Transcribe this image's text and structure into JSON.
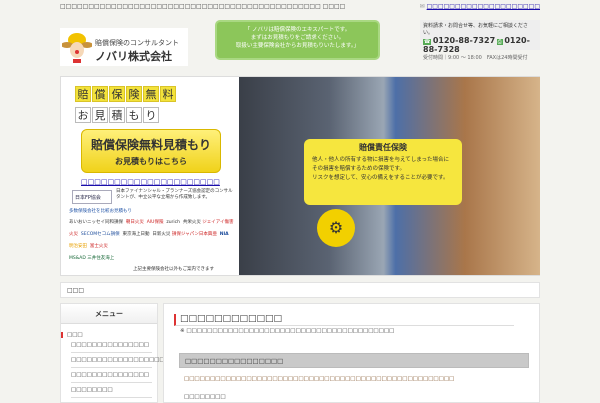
{
  "top": {
    "tagline": "□□□□□□□□□□□□□□□□□□□□□□□□□□□□□□□□□□□□□□□□□□□□□□ □□□□",
    "mail_link": "□□□□□□□□□□□□□□□□□□□□"
  },
  "logo": {
    "sub": "賠償保険のコンサルタント",
    "name": "ノバリ株式会社"
  },
  "banner": {
    "lines": [
      "「 ノバリは賠償保険のエキスパートです。",
      "まずはお見積もりをご請求ください。",
      "取扱い主要保険会社からお見積もりいたします。」"
    ]
  },
  "contact": {
    "note": "資料請求・お問合せ等、お気軽にご相談ください。",
    "tel": "0120-88-7327",
    "fax": "0120-88-7328",
    "hours": "受付時間｜9:00 〜 18:00　FAXは24時間受付"
  },
  "hero": {
    "row1": [
      "賠",
      "償",
      "保",
      "険",
      "無",
      "料"
    ],
    "row2": [
      "お",
      "見",
      "積",
      "も",
      "り"
    ],
    "cta_main": "賠償保険無料見積もり",
    "cta_sub": "お見積もりはこちら",
    "link": "□□□□□□□□□□□□□□□□□□□□□",
    "fp_badge": "日本FP協会",
    "fp_text": "日本ファイナンシャル・プランナーズ協会認定のコンサルタントが、中立公平な立場から作成致します。",
    "compare": "多数保険会社を比較お見積もり",
    "insurers": [
      "あいおいニッセイ同和損保",
      "朝日火災",
      "AIU保険",
      "zurich",
      "共栄火災",
      "ジェイアイ傷害火災",
      "SECOMセコム損保",
      "東京海上日動",
      "日新火災",
      "損保ジャパン日本興亜",
      "NIA",
      "明治安田",
      "富士火災",
      "MS&AD 三井住友海上"
    ],
    "others": "上記主要保険会社以外もご案内できます",
    "box_title": "賠償責任保険",
    "box_lines": [
      "他人・他人の所有する物に損害を与えてしまった場合に",
      "その損害を賠償するための保険です。",
      "リスクを想定して、安心の備えをすることが必要です。"
    ]
  },
  "breadcrumb": "□□□",
  "sidebar": {
    "title": "メニュー",
    "current": "□□□",
    "items": [
      "□□□□□□□□□□□□□□□",
      "□□□□□□□□□□□□□□□□□□□",
      "□□□□□□□□□□□□□□□",
      "□□□□□□□□"
    ]
  },
  "main": {
    "title": "□□□□□□□□□□□□",
    "note": "※ □□□□□□□□□□□□□□□□□□□□□□□□□□□□□□□□□□□□□□□□",
    "section": "□□□□□□□□□□□□□□□□",
    "lines": [
      "□□□□□□□□□□□□□□□□□□□□□□□□□□□□□□□□□□□□□□□□□□□□□□□□□□□□",
      "□□□□□□□□"
    ]
  }
}
